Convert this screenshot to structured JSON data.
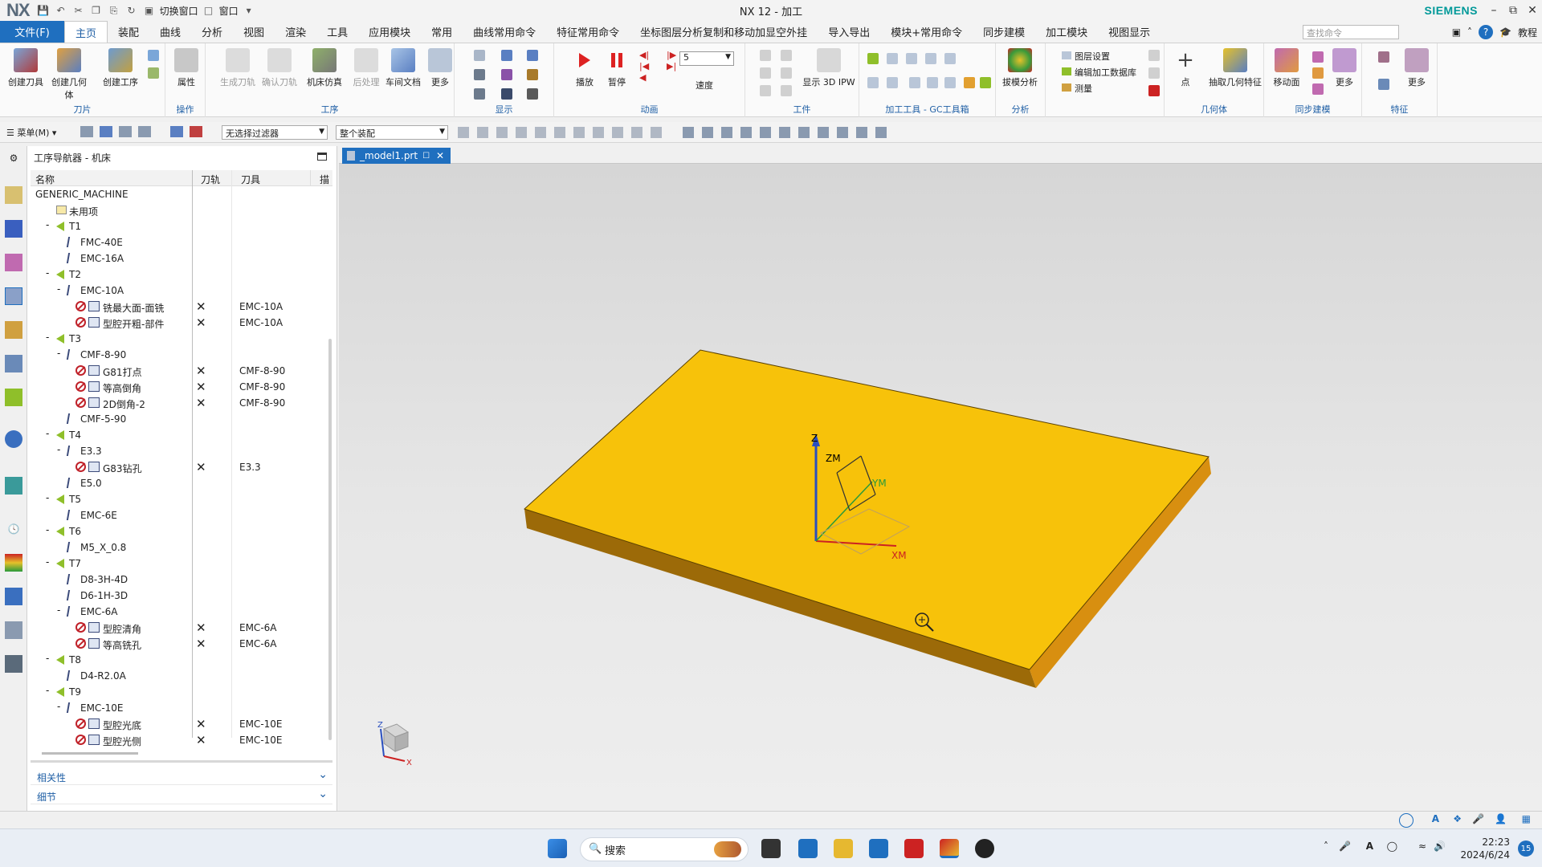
{
  "app": {
    "logo": "NX",
    "title": "NX 12 - 加工",
    "brand": "SIEMENS",
    "qa_switch_window": "切换窗口",
    "qa_window": "窗口"
  },
  "menu": {
    "file": "文件(F)",
    "tabs": [
      "主页",
      "装配",
      "曲线",
      "分析",
      "视图",
      "渲染",
      "工具",
      "应用模块",
      "常用",
      "曲线常用命令",
      "特征常用命令",
      "坐标图层分析复制和移动加显空外挂",
      "导入导出",
      "模块+常用命令",
      "同步建模",
      "加工模块",
      "视图显示"
    ],
    "search_placeholder": "查找命令",
    "help_label": "教程"
  },
  "ribbon": {
    "create_tool": "创建刀具",
    "create_geometry": "创建几何体",
    "create_operation": "创建工序",
    "properties": "属性",
    "generate_toolpath": "生成刀轨",
    "confirm_toolpath": "确认刀轨",
    "machine_sim": "机床仿真",
    "post_process": "后处理",
    "shop_doc": "车间文档",
    "more": "更多",
    "play": "播放",
    "pause": "暂停",
    "speed": "速度",
    "speed_value": "5",
    "show_3d_ipw": "显示 3D IPW",
    "draft_analysis": "拔模分析",
    "layer_settings": "图层设置",
    "edit_machining_db": "编辑加工数据库",
    "measure": "测量",
    "point": "点",
    "extract_geometry": "抽取几何特征",
    "move_face": "移动面",
    "more2": "更多",
    "more3": "更多",
    "groups": {
      "tool": "刀片",
      "operation": "操作",
      "process": "工序",
      "display": "显示",
      "animation": "动画",
      "workpiece": "工件",
      "gc_toolbox": "加工工具 - GC工具箱",
      "analysis": "分析",
      "geometry": "几何体",
      "sync_modeling": "同步建模",
      "feature": "特征"
    }
  },
  "toolbar2": {
    "menu": "菜单(M)",
    "filter": "无选择过滤器",
    "scope": "整个装配"
  },
  "navigator": {
    "title": "工序导航器 - 机床",
    "columns": {
      "name": "名称",
      "toolpath": "刀轨",
      "tool": "刀具",
      "desc": "描"
    },
    "rows": [
      {
        "level": 0,
        "icon": "none",
        "name": "GENERIC_MACHINE",
        "x": "",
        "tool": ""
      },
      {
        "level": 1,
        "icon": "folder",
        "name": "未用项",
        "x": "",
        "tool": ""
      },
      {
        "level": 1,
        "icon": "tri",
        "toggle": "-",
        "name": "T1",
        "x": "",
        "tool": ""
      },
      {
        "level": 2,
        "icon": "cut",
        "name": "FMC-40E",
        "x": "",
        "tool": ""
      },
      {
        "level": 2,
        "icon": "cut",
        "name": "EMC-16A",
        "x": "",
        "tool": ""
      },
      {
        "level": 1,
        "icon": "tri",
        "toggle": "-",
        "name": "T2",
        "x": "",
        "tool": ""
      },
      {
        "level": 2,
        "icon": "cut",
        "toggle": "-",
        "name": "EMC-10A",
        "x": "",
        "tool": ""
      },
      {
        "level": 3,
        "icon": "op",
        "name": "铣最大面-面铣",
        "x": "✕",
        "tool": "EMC-10A"
      },
      {
        "level": 3,
        "icon": "op",
        "name": "型腔开粗-部件",
        "x": "✕",
        "tool": "EMC-10A"
      },
      {
        "level": 1,
        "icon": "tri",
        "toggle": "-",
        "name": "T3",
        "x": "",
        "tool": ""
      },
      {
        "level": 2,
        "icon": "cut",
        "toggle": "-",
        "name": "CMF-8-90",
        "x": "",
        "tool": ""
      },
      {
        "level": 3,
        "icon": "op",
        "name": "G81打点",
        "x": "✕",
        "tool": "CMF-8-90"
      },
      {
        "level": 3,
        "icon": "op",
        "name": "等高倒角",
        "x": "✕",
        "tool": "CMF-8-90"
      },
      {
        "level": 3,
        "icon": "op",
        "name": "2D倒角-2",
        "x": "✕",
        "tool": "CMF-8-90"
      },
      {
        "level": 2,
        "icon": "cut",
        "name": "CMF-5-90",
        "x": "",
        "tool": ""
      },
      {
        "level": 1,
        "icon": "tri",
        "toggle": "-",
        "name": "T4",
        "x": "",
        "tool": ""
      },
      {
        "level": 2,
        "icon": "cut",
        "toggle": "-",
        "name": "E3.3",
        "x": "",
        "tool": ""
      },
      {
        "level": 3,
        "icon": "op",
        "name": "G83钻孔",
        "x": "✕",
        "tool": "E3.3"
      },
      {
        "level": 2,
        "icon": "cut",
        "name": "E5.0",
        "x": "",
        "tool": ""
      },
      {
        "level": 1,
        "icon": "tri",
        "toggle": "-",
        "name": "T5",
        "x": "",
        "tool": ""
      },
      {
        "level": 2,
        "icon": "cut",
        "name": "EMC-6E",
        "x": "",
        "tool": ""
      },
      {
        "level": 1,
        "icon": "tri",
        "toggle": "-",
        "name": "T6",
        "x": "",
        "tool": ""
      },
      {
        "level": 2,
        "icon": "cut",
        "name": "M5_X_0.8",
        "x": "",
        "tool": ""
      },
      {
        "level": 1,
        "icon": "tri",
        "toggle": "-",
        "name": "T7",
        "x": "",
        "tool": ""
      },
      {
        "level": 2,
        "icon": "cut",
        "name": "D8-3H-4D",
        "x": "",
        "tool": ""
      },
      {
        "level": 2,
        "icon": "cut",
        "name": "D6-1H-3D",
        "x": "",
        "tool": ""
      },
      {
        "level": 2,
        "icon": "cut",
        "toggle": "-",
        "name": "EMC-6A",
        "x": "",
        "tool": ""
      },
      {
        "level": 3,
        "icon": "op",
        "name": "型腔清角",
        "x": "✕",
        "tool": "EMC-6A"
      },
      {
        "level": 3,
        "icon": "op",
        "name": "等高铣孔",
        "x": "✕",
        "tool": "EMC-6A"
      },
      {
        "level": 1,
        "icon": "tri",
        "toggle": "-",
        "name": "T8",
        "x": "",
        "tool": ""
      },
      {
        "level": 2,
        "icon": "cut",
        "name": "D4-R2.0A",
        "x": "",
        "tool": ""
      },
      {
        "level": 1,
        "icon": "tri",
        "toggle": "-",
        "name": "T9",
        "x": "",
        "tool": ""
      },
      {
        "level": 2,
        "icon": "cut",
        "toggle": "-",
        "name": "EMC-10E",
        "x": "",
        "tool": ""
      },
      {
        "level": 3,
        "icon": "op",
        "name": "型腔光底",
        "x": "✕",
        "tool": "EMC-10E"
      },
      {
        "level": 3,
        "icon": "op",
        "name": "型腔光侧",
        "x": "✕",
        "tool": "EMC-10E"
      }
    ],
    "panel_dependencies": "相关性",
    "panel_details": "细节"
  },
  "document_tab": "_model1.prt",
  "viewport": {
    "csys": {
      "z": "Z",
      "zm": "ZM",
      "ym": "YM",
      "xm": "XM"
    },
    "triad": {
      "z": "Z",
      "x": "X"
    },
    "plate_top_color": "#f7c20a",
    "plate_front_color": "#9c6a08",
    "plate_side_color": "#d88f10"
  },
  "taskbar": {
    "search": "搜索",
    "time": "22:23",
    "date": "2024/6/24",
    "badge": "15"
  }
}
